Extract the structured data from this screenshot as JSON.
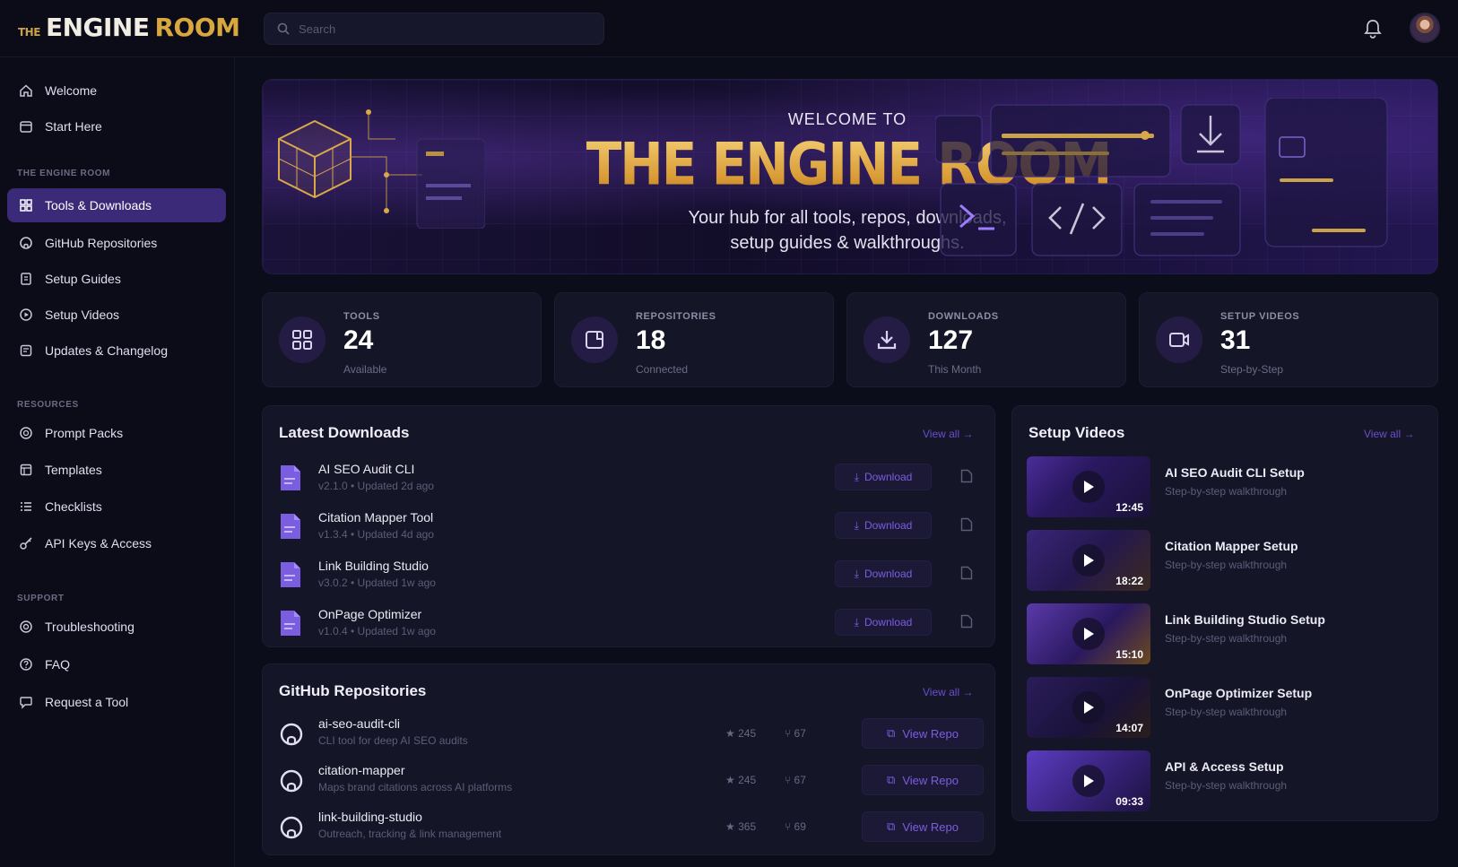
{
  "app": {
    "logo_the": "THE",
    "logo_engine": "ENGINE",
    "logo_room": "ROOM",
    "search_placeholder": "Search"
  },
  "sidebar": {
    "top_items": [
      {
        "label": "Welcome",
        "icon": "home-icon"
      },
      {
        "label": "Start Here",
        "icon": "calendar-icon"
      }
    ],
    "section_engine": "THE ENGINE ROOM",
    "engine_items": [
      {
        "label": "Tools & Downloads",
        "icon": "grid-icon",
        "active": true
      },
      {
        "label": "GitHub Repositories",
        "icon": "github-icon"
      },
      {
        "label": "Setup Guides",
        "icon": "book-icon"
      },
      {
        "label": "Setup Videos",
        "icon": "play-circle-icon"
      },
      {
        "label": "Updates & Changelog",
        "icon": "refresh-icon"
      }
    ],
    "section_resources": "RESOURCES",
    "resource_items": [
      {
        "label": "Prompt Packs",
        "icon": "layers-icon"
      },
      {
        "label": "Templates",
        "icon": "template-icon"
      },
      {
        "label": "Checklists",
        "icon": "checklist-icon"
      },
      {
        "label": "API Keys & Access",
        "icon": "key-icon"
      }
    ],
    "section_support": "SUPPORT",
    "support_items": [
      {
        "label": "Troubleshooting",
        "icon": "lifebuoy-icon"
      },
      {
        "label": "FAQ",
        "icon": "help-icon"
      },
      {
        "label": "Request a Tool",
        "icon": "message-icon"
      }
    ]
  },
  "hero": {
    "kicker": "WELCOME TO",
    "title": "THE ENGINE ROOM",
    "subtitle_line1": "Your hub for all tools, repos, downloads,",
    "subtitle_line2": "setup guides & walkthroughs."
  },
  "stats": [
    {
      "label": "TOOLS",
      "value": "24",
      "caption": "Available",
      "icon": "grid-icon"
    },
    {
      "label": "REPOSITORIES",
      "value": "18",
      "caption": "Connected",
      "icon": "repo-icon"
    },
    {
      "label": "DOWNLOADS",
      "value": "127",
      "caption": "This Month",
      "icon": "download-icon"
    },
    {
      "label": "SETUP VIDEOS",
      "value": "31",
      "caption": "Step-by-Step",
      "icon": "video-icon"
    }
  ],
  "latest_downloads": {
    "title": "Latest Downloads",
    "view_all": "View all →",
    "button_label": "Download",
    "items": [
      {
        "name": "AI SEO Audit CLI",
        "meta": "v2.1.0 • Updated 2d ago"
      },
      {
        "name": "Citation Mapper Tool",
        "meta": "v1.3.4 • Updated 4d ago"
      },
      {
        "name": "Link Building Studio",
        "meta": "v3.0.2 • Updated 1w ago"
      },
      {
        "name": "OnPage Optimizer",
        "meta": "v1.0.4 • Updated 1w ago"
      }
    ]
  },
  "github_repos": {
    "title": "GitHub Repositories",
    "view_all": "View all →",
    "button_label": "View Repo",
    "items": [
      {
        "name": "ai-seo-audit-cli",
        "desc": "CLI tool for deep AI SEO audits",
        "stars": "245",
        "forks": "67"
      },
      {
        "name": "citation-mapper",
        "desc": "Maps brand citations across AI platforms",
        "stars": "245",
        "forks": "67"
      },
      {
        "name": "link-building-studio",
        "desc": "Outreach, tracking & link management",
        "stars": "365",
        "forks": "69"
      }
    ]
  },
  "setup_videos": {
    "title": "Setup Videos",
    "view_all": "View all →",
    "items": [
      {
        "title": "AI SEO Audit CLI Setup",
        "sub": "Step-by-step walkthrough",
        "duration": "12:45"
      },
      {
        "title": "Citation Mapper Setup",
        "sub": "Step-by-step walkthrough",
        "duration": "18:22"
      },
      {
        "title": "Link Building Studio Setup",
        "sub": "Step-by-step walkthrough",
        "duration": "15:10"
      },
      {
        "title": "OnPage Optimizer Setup",
        "sub": "Step-by-step walkthrough",
        "duration": "14:07"
      },
      {
        "title": "API & Access Setup",
        "sub": "Step-by-step walkthrough",
        "duration": "09:33"
      }
    ]
  },
  "colors": {
    "accent": "#6a4fd1",
    "active_nav": "#3b2a78",
    "gold": "#e0ad4a",
    "background": "#0c0d1a",
    "card": "#141527"
  }
}
